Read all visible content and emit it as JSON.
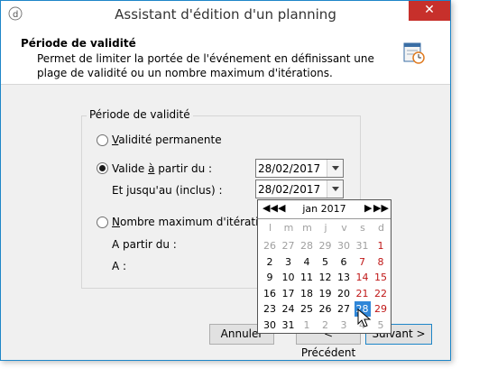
{
  "window": {
    "title": "Assistant d'édition d'un planning",
    "close": "✕"
  },
  "header": {
    "title": "Période de validité",
    "description": "Permet de limiter la portée de l'événement en définissant une plage de validité ou un nombre maximum d'itérations."
  },
  "group": {
    "label": "Période de validité",
    "opt_permanent": {
      "prefix": "",
      "accel": "V",
      "suffix": "alidité permanente",
      "checked": false
    },
    "opt_from": {
      "prefix": "Valide ",
      "accel": "à",
      "suffix": " partir du :",
      "checked": true
    },
    "from_date": "28/02/2017",
    "until_label": "Et jusqu'au (inclus) :",
    "until_date": "28/02/2017",
    "opt_max": {
      "prefix": "",
      "accel": "N",
      "suffix": "ombre maximum d'itérations",
      "checked": false
    },
    "start_label": "A partir du :",
    "to_label": "A :"
  },
  "buttons": {
    "cancel": "Annuler",
    "previous": "< Précédent",
    "next": "Suivant >"
  },
  "calendar": {
    "nav_prev_year": "◀◀",
    "nav_prev_month": "◀",
    "nav_next_month": "▶",
    "nav_next_year": "▶▶",
    "month": "jan 2017",
    "weekdays": [
      "l",
      "m",
      "m",
      "j",
      "v",
      "s",
      "d"
    ],
    "weeks": [
      [
        "26",
        "27",
        "28",
        "29",
        "30",
        "31",
        "1"
      ],
      [
        "2",
        "3",
        "4",
        "5",
        "6",
        "7",
        "8"
      ],
      [
        "9",
        "10",
        "11",
        "12",
        "13",
        "14",
        "15"
      ],
      [
        "16",
        "17",
        "18",
        "19",
        "20",
        "21",
        "22"
      ],
      [
        "23",
        "24",
        "25",
        "26",
        "27",
        "28",
        "29"
      ],
      [
        "30",
        "31",
        "1",
        "2",
        "3",
        "4",
        "5"
      ]
    ],
    "other_month": [
      [
        1,
        1,
        1,
        1,
        1,
        1,
        0
      ],
      [
        0,
        0,
        0,
        0,
        0,
        0,
        0
      ],
      [
        0,
        0,
        0,
        0,
        0,
        0,
        0
      ],
      [
        0,
        0,
        0,
        0,
        0,
        0,
        0
      ],
      [
        0,
        0,
        0,
        0,
        0,
        0,
        0
      ],
      [
        0,
        0,
        1,
        1,
        1,
        1,
        1
      ]
    ],
    "selected_day": "28"
  }
}
